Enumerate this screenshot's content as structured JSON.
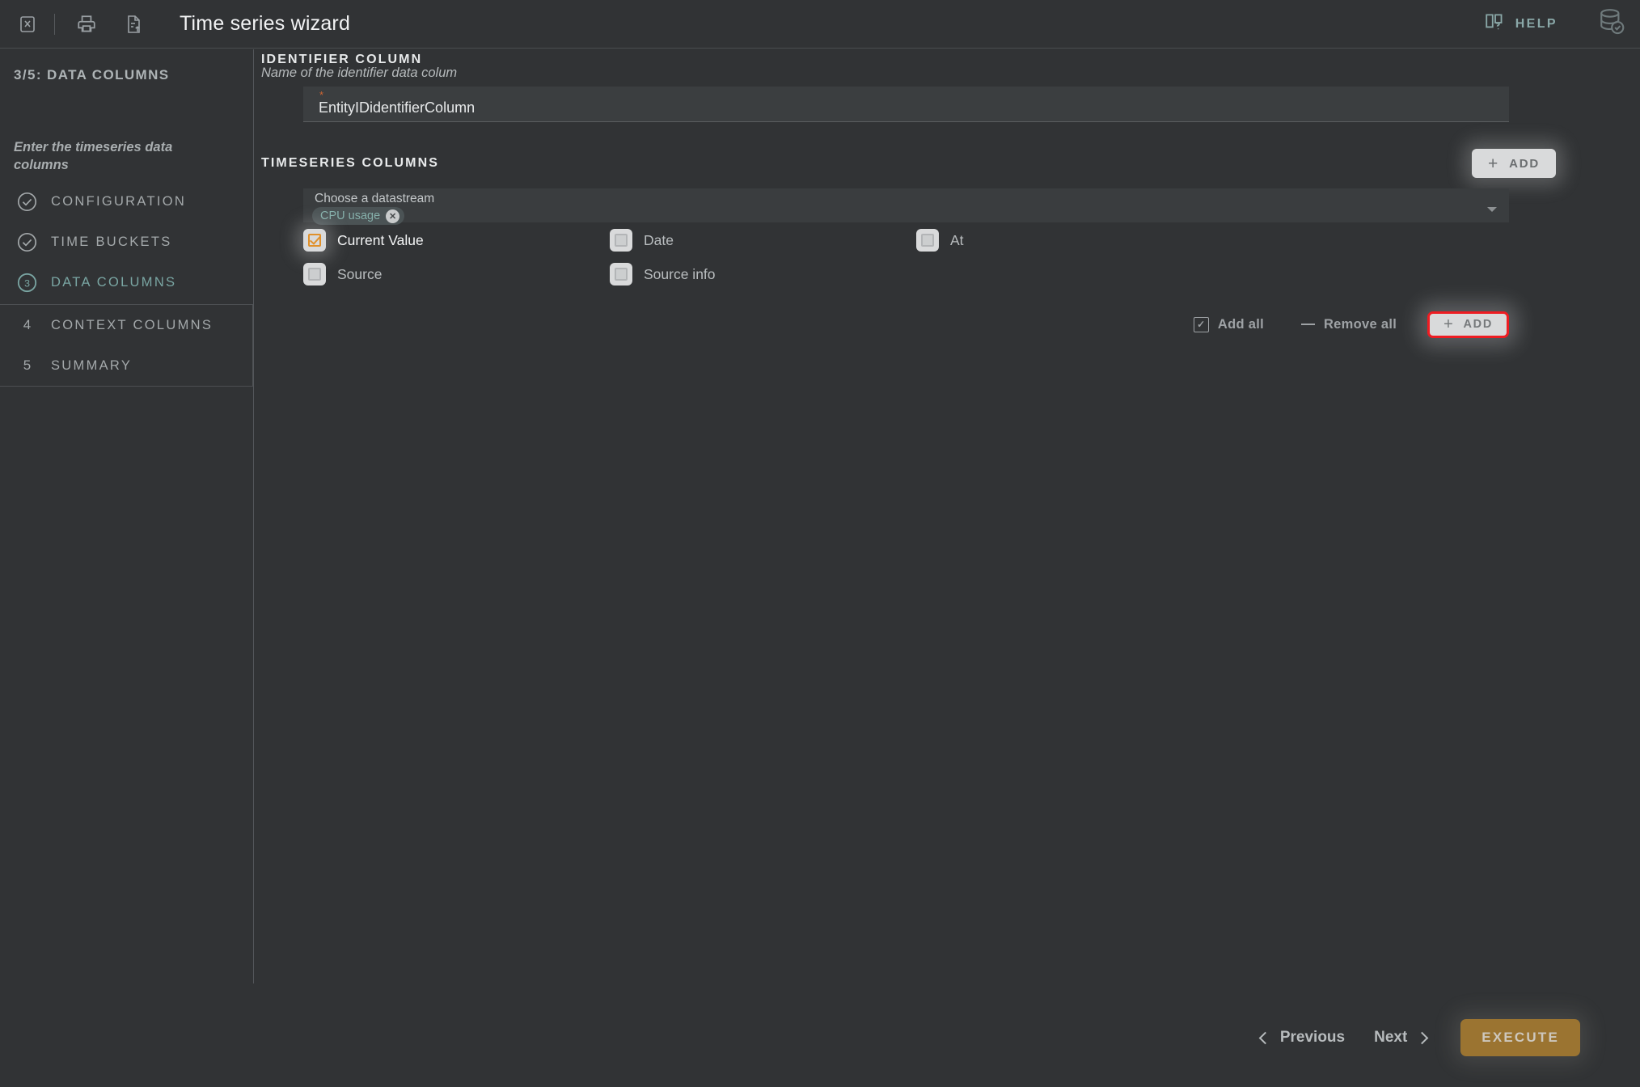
{
  "window": {
    "title": "Time series wizard",
    "close_icon": "close-x-icon",
    "print_icon": "printer-icon",
    "export_icon": "document-upload-icon",
    "help_label": "HELP",
    "help_icon": "book-question-icon",
    "database_icon": "database-check-icon"
  },
  "sidebar": {
    "step_title": "3/5: DATA COLUMNS",
    "description": "Enter the timeseries data columns",
    "steps": [
      {
        "num": "1",
        "label": "CONFIGURATION",
        "state": "complete",
        "mark": "check-circle-icon"
      },
      {
        "num": "2",
        "label": "TIME BUCKETS",
        "state": "complete",
        "mark": "check-circle-icon"
      },
      {
        "num": "3",
        "label": "DATA COLUMNS",
        "state": "active",
        "mark": "number-circle-icon"
      },
      {
        "num": "4",
        "label": "CONTEXT COLUMNS",
        "state": "pending",
        "mark": "number-plain"
      },
      {
        "num": "5",
        "label": "SUMMARY",
        "state": "pending",
        "mark": "number-plain"
      }
    ]
  },
  "identifier_section": {
    "label": "IDENTIFIER COLUMN",
    "hint": "Name of the identifier data colum",
    "required_marker": "*",
    "value": "EntityIDidentifierColumn",
    "placeholder": ""
  },
  "timeseries_section": {
    "label": "TIMESERIES COLUMNS",
    "add_top_label": "ADD",
    "add_top_icon": "plus-icon",
    "datastream": {
      "label": "Choose a datastream",
      "chips": [
        {
          "label": "CPU usage",
          "remove_icon": "chip-close-icon"
        }
      ],
      "caret_icon": "chevron-down-icon"
    },
    "columns": [
      {
        "label": "Current Value",
        "checked": true
      },
      {
        "label": "Date",
        "checked": false
      },
      {
        "label": "At",
        "checked": false
      },
      {
        "label": "Source",
        "checked": false
      },
      {
        "label": "Source info",
        "checked": false
      }
    ],
    "actions": {
      "add_all_label": "Add all",
      "add_all_icon": "checkbox-check-icon",
      "remove_all_label": "Remove all",
      "remove_all_icon": "minus-icon",
      "add_label": "ADD",
      "add_icon": "plus-icon"
    }
  },
  "footer": {
    "previous_label": "Previous",
    "previous_icon": "chevron-left-icon",
    "next_label": "Next",
    "next_icon": "chevron-right-icon",
    "execute_label": "EXECUTE"
  },
  "colors": {
    "background": "#313335",
    "accent_teal": "#7aa6a3",
    "accent_orange": "#e0902a",
    "required_red": "#cf6633",
    "highlight_red": "#ee1c22",
    "execute_amber": "#9b7431"
  }
}
